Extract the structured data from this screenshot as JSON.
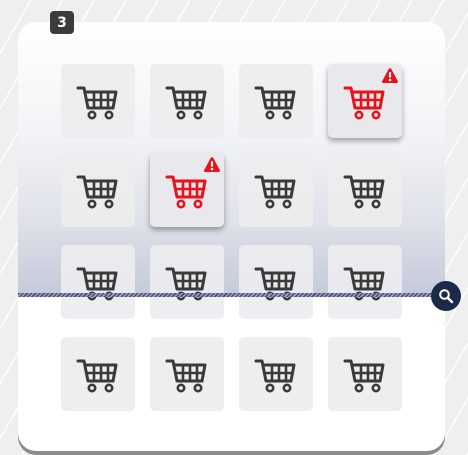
{
  "step_badge": {
    "number": "3"
  },
  "colors": {
    "cart_normal": "#3a3a3a",
    "cart_alert": "#e8121b",
    "alert_badge": "#e8121b",
    "search_button": "#1c2a4a",
    "badge_bg": "#3b3b3b"
  },
  "grid": {
    "rows": 4,
    "columns": 4,
    "tiles": [
      {
        "icon": "shopping-cart-icon",
        "alert": false
      },
      {
        "icon": "shopping-cart-icon",
        "alert": false
      },
      {
        "icon": "shopping-cart-icon",
        "alert": false
      },
      {
        "icon": "shopping-cart-icon",
        "alert": true
      },
      {
        "icon": "shopping-cart-icon",
        "alert": false
      },
      {
        "icon": "shopping-cart-icon",
        "alert": true
      },
      {
        "icon": "shopping-cart-icon",
        "alert": false
      },
      {
        "icon": "shopping-cart-icon",
        "alert": false
      },
      {
        "icon": "shopping-cart-icon",
        "alert": false
      },
      {
        "icon": "shopping-cart-icon",
        "alert": false
      },
      {
        "icon": "shopping-cart-icon",
        "alert": false
      },
      {
        "icon": "shopping-cart-icon",
        "alert": false
      },
      {
        "icon": "shopping-cart-icon",
        "alert": false
      },
      {
        "icon": "shopping-cart-icon",
        "alert": false
      },
      {
        "icon": "shopping-cart-icon",
        "alert": false
      },
      {
        "icon": "shopping-cart-icon",
        "alert": false
      }
    ]
  },
  "search": {
    "icon": "magnifier-icon"
  }
}
